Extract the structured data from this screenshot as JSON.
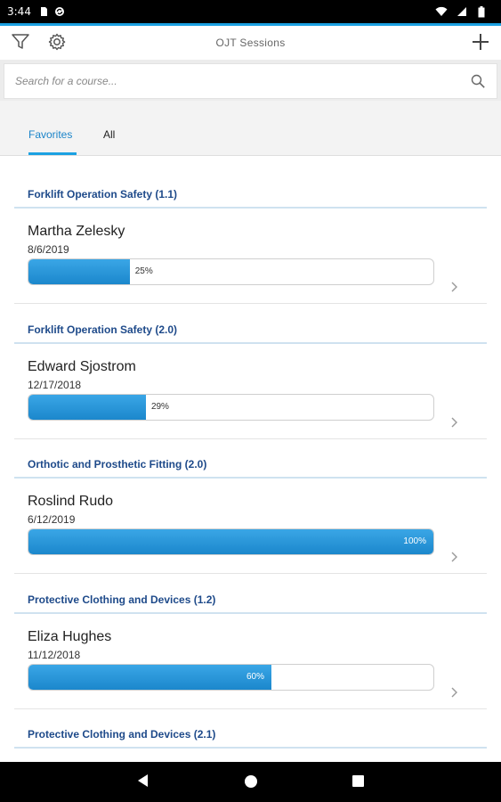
{
  "status_bar": {
    "time": "3:44",
    "icons": [
      "sd-card-icon",
      "sync-icon",
      "wifi-icon",
      "signal-icon",
      "battery-icon"
    ]
  },
  "toolbar": {
    "title": "OJT Sessions",
    "left_icons": [
      "filter-icon",
      "gear-icon"
    ],
    "right_icon": "plus-icon"
  },
  "search": {
    "placeholder": "Search for a course...",
    "value": ""
  },
  "tabs": [
    {
      "label": "Favorites",
      "active": true
    },
    {
      "label": "All",
      "active": false
    }
  ],
  "colors": {
    "accent": "#1ba1e2",
    "header_text": "#1e4a8a",
    "progress_fill": "#2a96d8"
  },
  "courses": [
    {
      "title": "Forklift Operation Safety (1.1)",
      "person": "Martha Zelesky",
      "date": "8/6/2019",
      "progress": 25,
      "progress_label": "25%"
    },
    {
      "title": "Forklift Operation Safety (2.0)",
      "person": "Edward Sjostrom",
      "date": "12/17/2018",
      "progress": 29,
      "progress_label": "29%"
    },
    {
      "title": "Orthotic and Prosthetic Fitting (2.0)",
      "person": "Roslind Rudo",
      "date": "6/12/2019",
      "progress": 100,
      "progress_label": "100%"
    },
    {
      "title": "Protective Clothing and Devices (1.2)",
      "person": "Eliza Hughes",
      "date": "11/12/2018",
      "progress": 60,
      "progress_label": "60%"
    },
    {
      "title": "Protective Clothing and Devices (2.1)"
    }
  ],
  "nav_bar": [
    "back-icon",
    "home-icon",
    "recents-icon"
  ]
}
